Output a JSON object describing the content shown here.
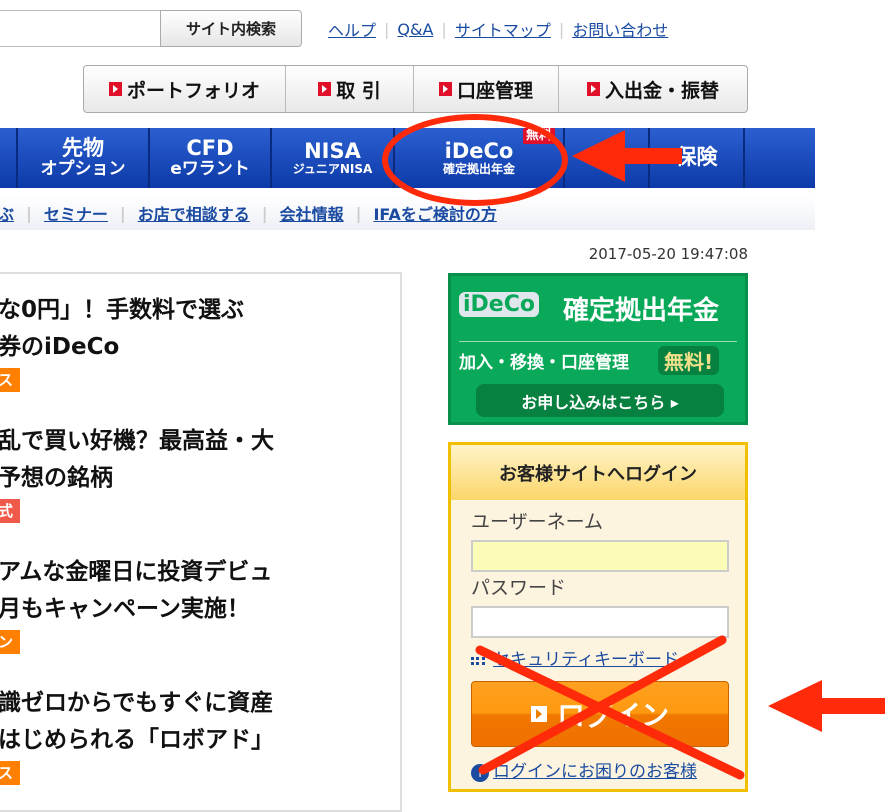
{
  "header": {
    "search_button": "サイト内検索",
    "links": [
      "ヘルプ",
      "Q&A",
      "サイトマップ",
      "お問い合わせ"
    ]
  },
  "tabs": [
    "ポートフォリオ",
    "取 引",
    "口座管理",
    "入出金・振替"
  ],
  "nav": [
    {
      "l1": "先物",
      "l2": "オプション"
    },
    {
      "l1": "CFD",
      "l2": "eワラント"
    },
    {
      "l1": "NISA",
      "l2": "ジュニアNISA"
    },
    {
      "l1": "iDeCo",
      "l2": "確定拠出年金",
      "badge": "無料"
    },
    {
      "l1": "",
      "l2": ""
    },
    {
      "l1": "保険",
      "l2": ""
    }
  ],
  "subnav": [
    "ぶ",
    "セミナー",
    "お店で相談する",
    "会社情報",
    "IFAをご検討の方"
  ],
  "datetime": "2017-05-20 19:47:08",
  "articles": [
    {
      "line1": "な0円」！手数料で選ぶ",
      "line2": "券のiDeCo",
      "tag": "ス",
      "tag_color": "#ff7f00"
    },
    {
      "line1": "乱で買い好機？最高益・大",
      "line2": "予想の銘柄",
      "tag": "式",
      "tag_color": "#f05a4a"
    },
    {
      "line1": "アムな金曜日に投資デビュ",
      "line2": "月もキャンペーン実施！",
      "tag": "ン",
      "tag_color": "#ff7f00"
    },
    {
      "line1": "識ゼロからでもすぐに資産",
      "line2": "はじめられる「ロボアド」",
      "tag": "ス",
      "tag_color": "#ff7f00"
    }
  ],
  "ideco_banner": {
    "logo": "iDeCo",
    "title": "確定拠出年金",
    "subtitle": "加入・移換・口座管理",
    "free": "無料!",
    "cta": "お申し込みはこちら ▸"
  },
  "login": {
    "title": "お客様サイトへログイン",
    "username_label": "ユーザーネーム",
    "username_value": "",
    "password_label": "パスワード",
    "password_value": "",
    "security_keyboard": "セキュリティキーボード",
    "login_button": "ログイン",
    "help_link": "ログインにお困りのお客様"
  },
  "colors": {
    "nav_blue": "#1a4bc0",
    "green": "#0aa95a",
    "login_orange": "#ff9a10",
    "annotation_red": "#ff2a0a"
  }
}
